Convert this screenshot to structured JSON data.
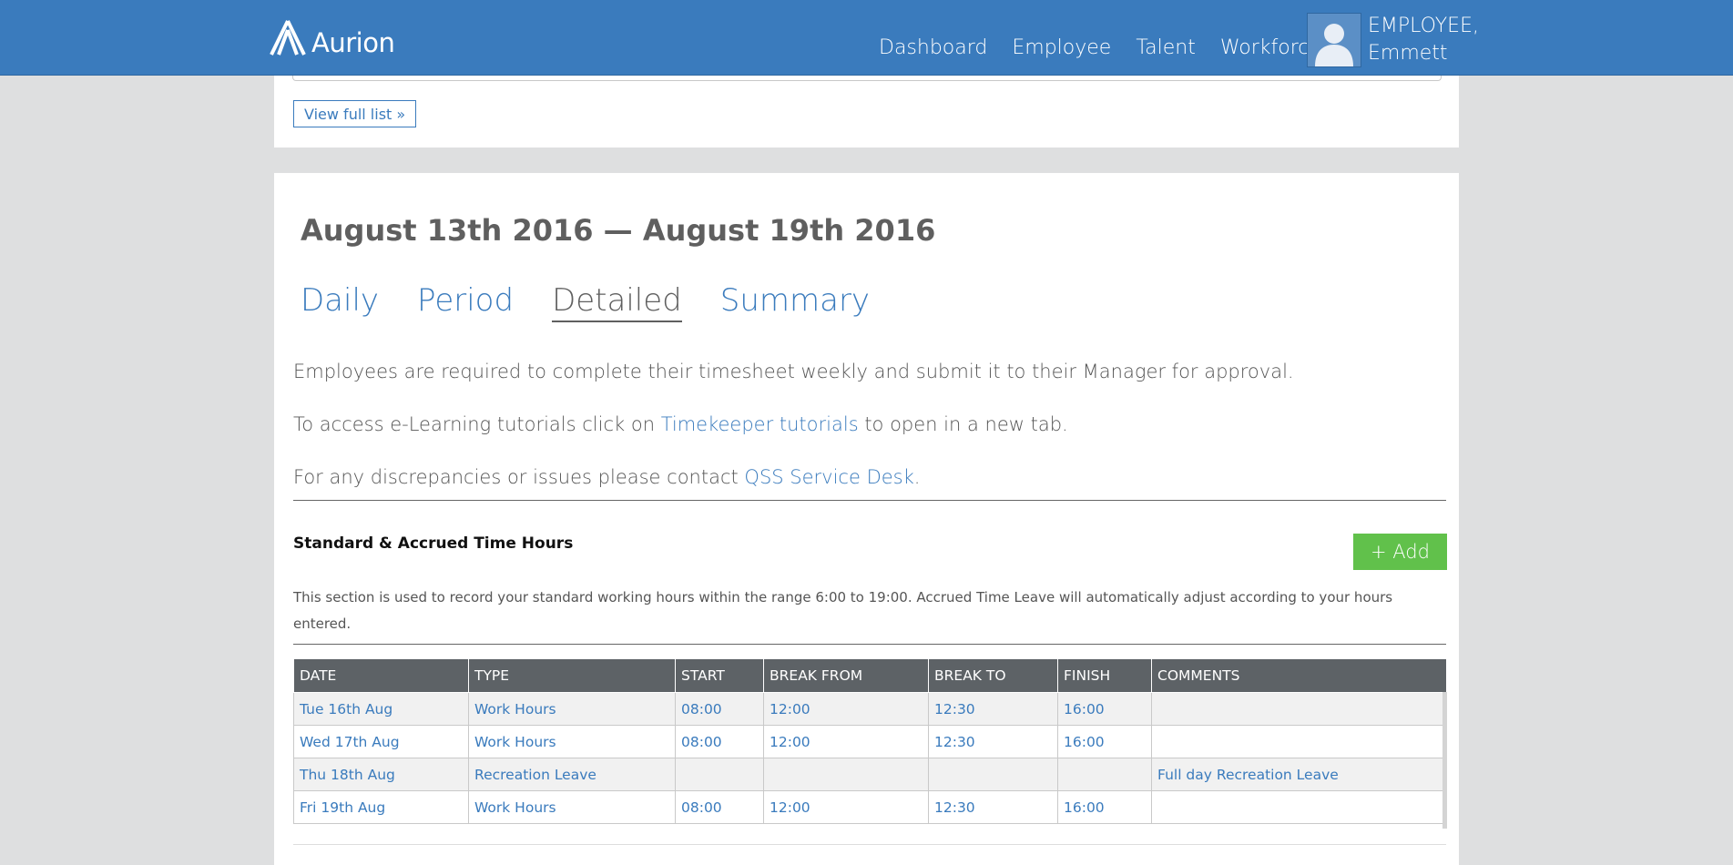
{
  "header": {
    "logo_text": "Aurion",
    "nav": [
      "Dashboard",
      "Employee",
      "Talent",
      "Workforce"
    ],
    "user": {
      "line1": "EMPLOYEE,",
      "line2": "Emmett"
    }
  },
  "top_panel": {
    "view_full_list": "View full list »"
  },
  "main": {
    "title": "August 13th 2016 — August 19th 2016",
    "tabs": [
      "Daily",
      "Period",
      "Detailed",
      "Summary"
    ],
    "active_tab": "Detailed",
    "p1": "Employees are required to complete their timesheet weekly and submit it to their Manager for approval.",
    "p2_before": "To access e-Learning tutorials click on ",
    "p2_link": "Timekeeper tutorials",
    "p2_after": " to open in a new tab.",
    "p3_before": "For any discrepancies or issues please contact ",
    "p3_link": "QSS Service Desk",
    "p3_after": ".",
    "section_title": "Standard & Accrued Time Hours",
    "add_label": "+ Add",
    "note": "This section is used to record your standard working hours within the range 6:00 to 19:00. Accrued Time Leave will automatically adjust according to your hours entered."
  },
  "table": {
    "columns": [
      "DATE",
      "TYPE",
      "START",
      "BREAK FROM",
      "BREAK TO",
      "FINISH",
      "COMMENTS"
    ],
    "rows": [
      [
        "Tue 16th Aug",
        "Work Hours",
        "08:00",
        "12:00",
        "12:30",
        "16:00",
        ""
      ],
      [
        "Wed 17th Aug",
        "Work Hours",
        "08:00",
        "12:00",
        "12:30",
        "16:00",
        ""
      ],
      [
        "Thu 18th Aug",
        "Recreation Leave",
        "",
        "",
        "",
        "",
        "Full day Recreation Leave"
      ],
      [
        "Fri 19th Aug",
        "Work Hours",
        "08:00",
        "12:00",
        "12:30",
        "16:00",
        ""
      ]
    ]
  },
  "colors": {
    "header_blue": "#3a7bbd",
    "link_blue": "#3a7bbd",
    "add_green": "#61c14b",
    "table_header": "#5d6266"
  }
}
